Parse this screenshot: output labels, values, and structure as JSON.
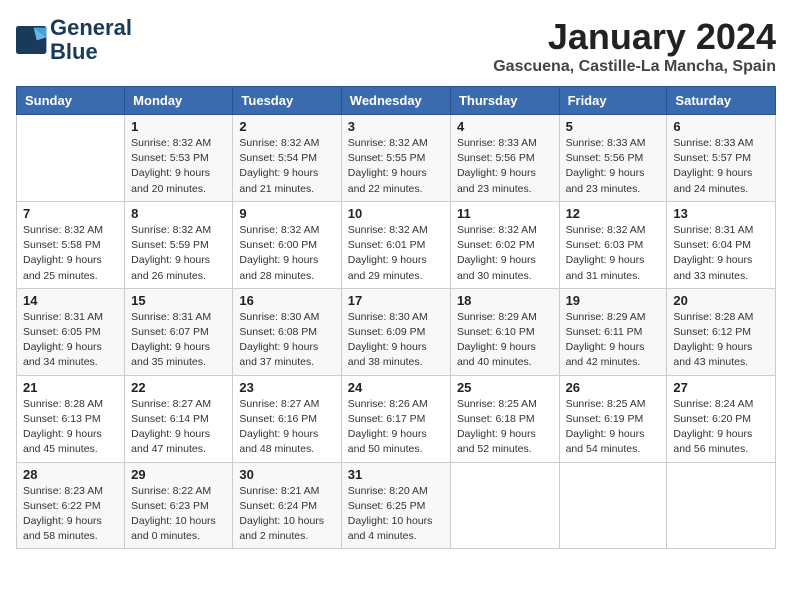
{
  "logo": {
    "line1": "General",
    "line2": "Blue"
  },
  "title": "January 2024",
  "location": "Gascuena, Castille-La Mancha, Spain",
  "days_of_week": [
    "Sunday",
    "Monday",
    "Tuesday",
    "Wednesday",
    "Thursday",
    "Friday",
    "Saturday"
  ],
  "weeks": [
    [
      {
        "num": "",
        "info": ""
      },
      {
        "num": "1",
        "info": "Sunrise: 8:32 AM\nSunset: 5:53 PM\nDaylight: 9 hours\nand 20 minutes."
      },
      {
        "num": "2",
        "info": "Sunrise: 8:32 AM\nSunset: 5:54 PM\nDaylight: 9 hours\nand 21 minutes."
      },
      {
        "num": "3",
        "info": "Sunrise: 8:32 AM\nSunset: 5:55 PM\nDaylight: 9 hours\nand 22 minutes."
      },
      {
        "num": "4",
        "info": "Sunrise: 8:33 AM\nSunset: 5:56 PM\nDaylight: 9 hours\nand 23 minutes."
      },
      {
        "num": "5",
        "info": "Sunrise: 8:33 AM\nSunset: 5:56 PM\nDaylight: 9 hours\nand 23 minutes."
      },
      {
        "num": "6",
        "info": "Sunrise: 8:33 AM\nSunset: 5:57 PM\nDaylight: 9 hours\nand 24 minutes."
      }
    ],
    [
      {
        "num": "7",
        "info": "Sunrise: 8:32 AM\nSunset: 5:58 PM\nDaylight: 9 hours\nand 25 minutes."
      },
      {
        "num": "8",
        "info": "Sunrise: 8:32 AM\nSunset: 5:59 PM\nDaylight: 9 hours\nand 26 minutes."
      },
      {
        "num": "9",
        "info": "Sunrise: 8:32 AM\nSunset: 6:00 PM\nDaylight: 9 hours\nand 28 minutes."
      },
      {
        "num": "10",
        "info": "Sunrise: 8:32 AM\nSunset: 6:01 PM\nDaylight: 9 hours\nand 29 minutes."
      },
      {
        "num": "11",
        "info": "Sunrise: 8:32 AM\nSunset: 6:02 PM\nDaylight: 9 hours\nand 30 minutes."
      },
      {
        "num": "12",
        "info": "Sunrise: 8:32 AM\nSunset: 6:03 PM\nDaylight: 9 hours\nand 31 minutes."
      },
      {
        "num": "13",
        "info": "Sunrise: 8:31 AM\nSunset: 6:04 PM\nDaylight: 9 hours\nand 33 minutes."
      }
    ],
    [
      {
        "num": "14",
        "info": "Sunrise: 8:31 AM\nSunset: 6:05 PM\nDaylight: 9 hours\nand 34 minutes."
      },
      {
        "num": "15",
        "info": "Sunrise: 8:31 AM\nSunset: 6:07 PM\nDaylight: 9 hours\nand 35 minutes."
      },
      {
        "num": "16",
        "info": "Sunrise: 8:30 AM\nSunset: 6:08 PM\nDaylight: 9 hours\nand 37 minutes."
      },
      {
        "num": "17",
        "info": "Sunrise: 8:30 AM\nSunset: 6:09 PM\nDaylight: 9 hours\nand 38 minutes."
      },
      {
        "num": "18",
        "info": "Sunrise: 8:29 AM\nSunset: 6:10 PM\nDaylight: 9 hours\nand 40 minutes."
      },
      {
        "num": "19",
        "info": "Sunrise: 8:29 AM\nSunset: 6:11 PM\nDaylight: 9 hours\nand 42 minutes."
      },
      {
        "num": "20",
        "info": "Sunrise: 8:28 AM\nSunset: 6:12 PM\nDaylight: 9 hours\nand 43 minutes."
      }
    ],
    [
      {
        "num": "21",
        "info": "Sunrise: 8:28 AM\nSunset: 6:13 PM\nDaylight: 9 hours\nand 45 minutes."
      },
      {
        "num": "22",
        "info": "Sunrise: 8:27 AM\nSunset: 6:14 PM\nDaylight: 9 hours\nand 47 minutes."
      },
      {
        "num": "23",
        "info": "Sunrise: 8:27 AM\nSunset: 6:16 PM\nDaylight: 9 hours\nand 48 minutes."
      },
      {
        "num": "24",
        "info": "Sunrise: 8:26 AM\nSunset: 6:17 PM\nDaylight: 9 hours\nand 50 minutes."
      },
      {
        "num": "25",
        "info": "Sunrise: 8:25 AM\nSunset: 6:18 PM\nDaylight: 9 hours\nand 52 minutes."
      },
      {
        "num": "26",
        "info": "Sunrise: 8:25 AM\nSunset: 6:19 PM\nDaylight: 9 hours\nand 54 minutes."
      },
      {
        "num": "27",
        "info": "Sunrise: 8:24 AM\nSunset: 6:20 PM\nDaylight: 9 hours\nand 56 minutes."
      }
    ],
    [
      {
        "num": "28",
        "info": "Sunrise: 8:23 AM\nSunset: 6:22 PM\nDaylight: 9 hours\nand 58 minutes."
      },
      {
        "num": "29",
        "info": "Sunrise: 8:22 AM\nSunset: 6:23 PM\nDaylight: 10 hours\nand 0 minutes."
      },
      {
        "num": "30",
        "info": "Sunrise: 8:21 AM\nSunset: 6:24 PM\nDaylight: 10 hours\nand 2 minutes."
      },
      {
        "num": "31",
        "info": "Sunrise: 8:20 AM\nSunset: 6:25 PM\nDaylight: 10 hours\nand 4 minutes."
      },
      {
        "num": "",
        "info": ""
      },
      {
        "num": "",
        "info": ""
      },
      {
        "num": "",
        "info": ""
      }
    ]
  ]
}
